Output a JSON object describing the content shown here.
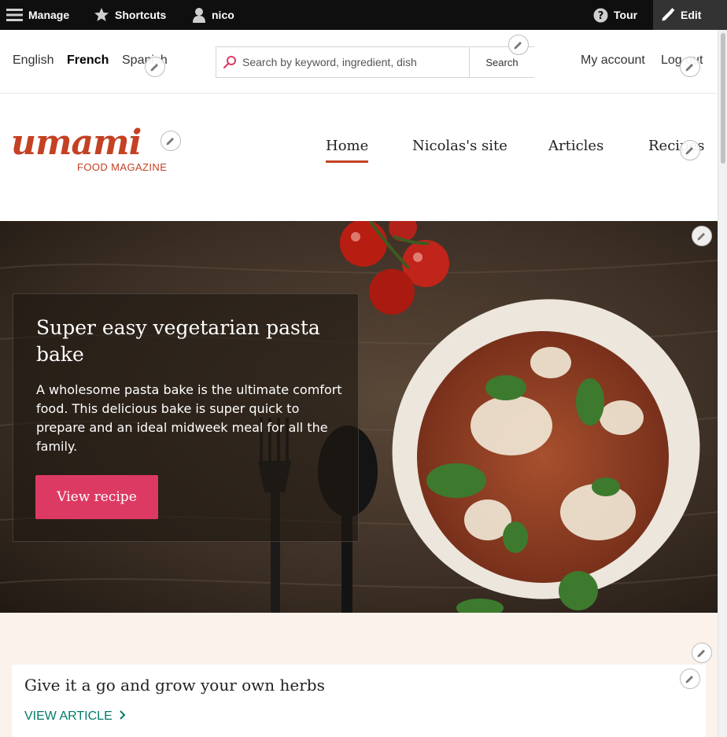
{
  "toolbar": {
    "manage": "Manage",
    "shortcuts": "Shortcuts",
    "user": "nico",
    "tour": "Tour",
    "edit": "Edit"
  },
  "languages": [
    "English",
    "French",
    "Spanish"
  ],
  "active_language": "French",
  "search": {
    "placeholder": "Search by keyword, ingredient, dish",
    "button": "Search"
  },
  "account": {
    "my_account": "My account",
    "logout": "Log out"
  },
  "brand": {
    "logo": "umami",
    "tagline": "FOOD MAGAZINE"
  },
  "nav": {
    "home": "Home",
    "site": "Nicolas's site",
    "articles": "Articles",
    "recipes": "Recipes",
    "active": "Home"
  },
  "hero": {
    "title": "Super easy vegetarian pasta bake",
    "body": "A wholesome pasta bake is the ultimate comfort food. This delicious bake is super quick to prepare and an ideal midweek meal for all the family.",
    "button": "View recipe"
  },
  "promo": {
    "title": "Give it a go and grow your own herbs",
    "link": "VIEW ARTICLE"
  },
  "colors": {
    "brand": "#c44124",
    "button": "#dd3a63",
    "link": "#007c6a",
    "section_bg": "#fbf2ec",
    "toolbar": "#0f0f0f"
  }
}
